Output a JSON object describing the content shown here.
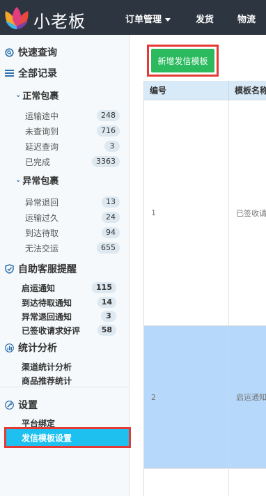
{
  "header": {
    "brand": "小老板",
    "nav": [
      {
        "label": "订单管理"
      },
      {
        "label": "发货"
      },
      {
        "label": "物流"
      }
    ]
  },
  "sidebar": {
    "quick_query": "快速查询",
    "all_records": "全部记录",
    "normal_pkg": "正常包裹",
    "normal_items": [
      {
        "label": "运输途中",
        "count": "248"
      },
      {
        "label": "未查询到",
        "count": "716"
      },
      {
        "label": "延迟查询",
        "count": "3"
      },
      {
        "label": "已完成",
        "count": "3363"
      }
    ],
    "abnormal_pkg": "异常包裹",
    "abnormal_items": [
      {
        "label": "异常退回",
        "count": "13"
      },
      {
        "label": "运输过久",
        "count": "24"
      },
      {
        "label": "到达待取",
        "count": "94"
      },
      {
        "label": "无法交运",
        "count": "655"
      }
    ],
    "reminder": "自助客服提醒",
    "reminder_items": [
      {
        "label": "启运通知",
        "count": "115"
      },
      {
        "label": "到达待取通知",
        "count": "14"
      },
      {
        "label": "异常退回通知",
        "count": "3"
      },
      {
        "label": "已签收请求好评",
        "count": "58"
      }
    ],
    "stats": "统计分析",
    "stats_items": [
      {
        "label": "渠道统计分析"
      },
      {
        "label": "商品推荐统计"
      }
    ],
    "settings": "设置",
    "settings_items": [
      {
        "label": "平台绑定"
      },
      {
        "label": "发信模板设置"
      }
    ]
  },
  "main": {
    "add_button": "新增发信模板",
    "table": {
      "headers": [
        "编号",
        "模板名称"
      ],
      "rows": [
        {
          "id": "1",
          "name": "已签收请求好评"
        },
        {
          "id": "2",
          "name": "启运通知"
        }
      ]
    }
  },
  "colors": {
    "topbar": "#2d3640",
    "accent_blue": "#1ec0f0",
    "add_green": "#2bbb5e",
    "highlight_red": "#e53935",
    "selected_row": "#b5d8fb"
  }
}
